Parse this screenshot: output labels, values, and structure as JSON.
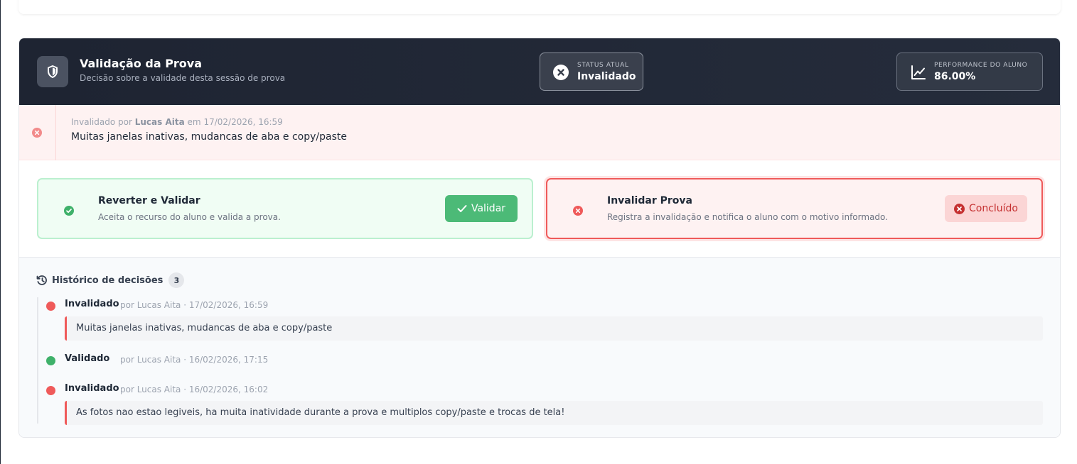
{
  "header": {
    "title": "Validação da Prova",
    "subtitle": "Decisão sobre a validade desta sessão de prova",
    "status": {
      "label": "STATUS ATUAL",
      "value": "Invalidado",
      "icon": "x-circle-icon"
    },
    "performance": {
      "label": "PERFORMANCE DO ALUNO",
      "value": "86.00%",
      "icon": "chart-line-icon"
    }
  },
  "banner": {
    "prefix": "Invalidado por",
    "author": "Lucas Aita",
    "date_prefix": "em",
    "date": "17/02/2026, 16:59",
    "message": "Muitas janelas inativas, mudancas de aba e copy/paste"
  },
  "actions": {
    "validate": {
      "title": "Reverter e Validar",
      "description": "Aceita o recurso do aluno e valida a prova.",
      "button": "Validar"
    },
    "invalidate": {
      "title": "Invalidar Prova",
      "description": "Registra a invalidação e notifica o aluno com o motivo informado.",
      "button": "Concluído"
    }
  },
  "history": {
    "title": "Histórico de decisões",
    "count": "3",
    "items": [
      {
        "status": "Invalidado",
        "meta": "por Lucas Aita · 17/02/2026, 16:59",
        "note": "Muitas janelas inativas, mudancas de aba e copy/paste",
        "color": "#ef5a5a"
      },
      {
        "status": "Validado",
        "meta": "por Lucas Aita · 16/02/2026, 17:15",
        "note": "",
        "color": "#3fb16a"
      },
      {
        "status": "Invalidado",
        "meta": "por Lucas Aita · 16/02/2026, 16:02",
        "note": "As fotos nao estao legiveis, ha muita inatividade durante a prova e multiplos copy/paste e trocas de tela!",
        "color": "#ef5a5a"
      }
    ]
  }
}
